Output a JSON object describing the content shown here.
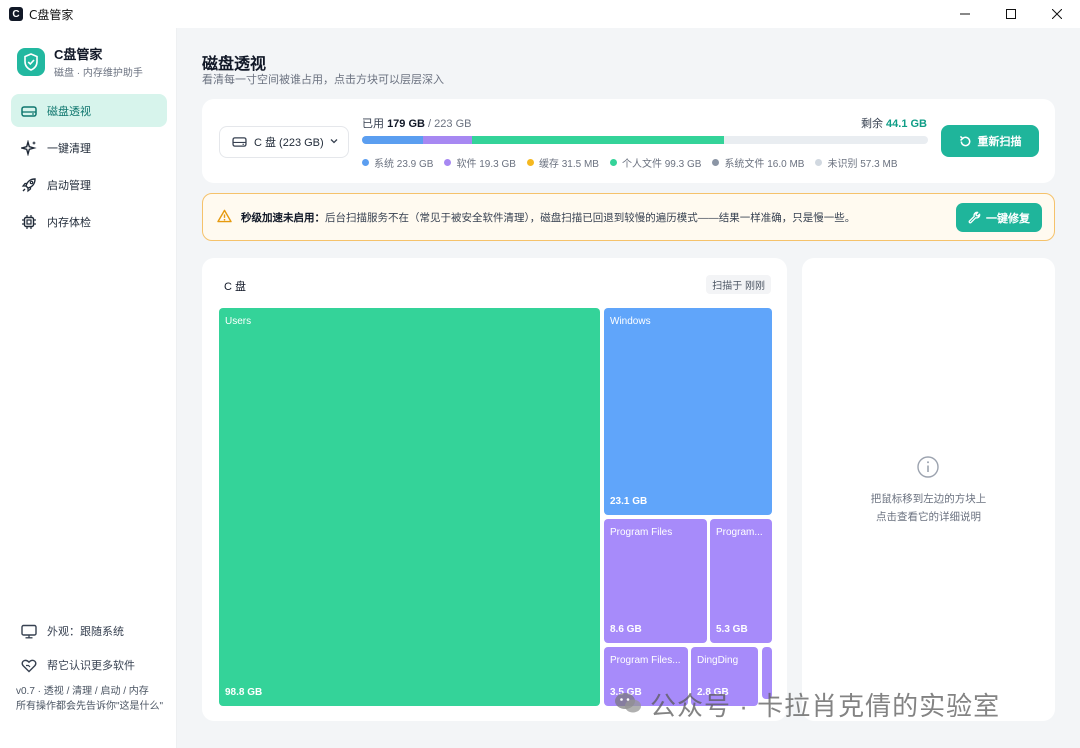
{
  "window": {
    "title": "C盘管家",
    "logo_glyph": "C"
  },
  "brand": {
    "name": "C盘管家",
    "subtitle": "磁盘 · 内存维护助手",
    "accent": "#22b8a0"
  },
  "nav": [
    {
      "label": "磁盘透视",
      "icon": "hard-drive-icon",
      "active": true
    },
    {
      "label": "一键清理",
      "icon": "sparkle-icon",
      "active": false
    },
    {
      "label": "启动管理",
      "icon": "rocket-icon",
      "active": false
    },
    {
      "label": "内存体检",
      "icon": "chip-icon",
      "active": false
    }
  ],
  "sidebar_bottom": {
    "appearance": "外观：跟随系统",
    "learn_more": "帮它认识更多软件",
    "footnote": "v0.7 · 透视 / 清理 / 启动 / 内存\n所有操作都会先告诉你\"这是什么\""
  },
  "page": {
    "title": "磁盘透视",
    "subtitle": "看清每一寸空间被谁占用，点击方块可以层层深入"
  },
  "usage": {
    "drive_label": "C 盘 (223 GB)",
    "used_prefix": "已用",
    "used_value": "179 GB",
    "used_total": "/ 223 GB",
    "free_prefix": "剩余",
    "free_value": "44.1 GB",
    "rescan_label": "重新扫描",
    "segments": [
      {
        "name": "系统",
        "label": "系统 23.9 GB",
        "color": "#5b9ef0",
        "gb": 23.9
      },
      {
        "name": "软件",
        "label": "软件 19.3 GB",
        "color": "#a788f2",
        "gb": 19.3
      },
      {
        "name": "缓存",
        "label": "缓存 31.5 MB",
        "color": "#f5b820",
        "gb": 0.03
      },
      {
        "name": "个人文件",
        "label": "个人文件 99.3 GB",
        "color": "#34d399",
        "gb": 99.3
      },
      {
        "name": "系统文件",
        "label": "系统文件 16.0 MB",
        "color": "#8b95a5",
        "gb": 0.016
      },
      {
        "name": "未识别",
        "label": "未识别 57.3 MB",
        "color": "#d1d8e0",
        "gb": 0.057
      }
    ]
  },
  "warning": {
    "title": "秒级加速未启用：",
    "body": "后台扫描服务不在（常见于被安全软件清理），磁盘扫描已回退到较慢的遍历模式——结果一样准确，只是慢一些。",
    "fix_label": "一键修复"
  },
  "treemap": {
    "title": "C 盘",
    "scan_badge": "扫描于 刚刚",
    "tiles": [
      {
        "name": "Users",
        "size": "98.8 GB",
        "color": "#34d399"
      },
      {
        "name": "Windows",
        "size": "23.1 GB",
        "color": "#60a5fa"
      },
      {
        "name": "Program Files",
        "size": "8.6 GB",
        "color": "#a78bfa"
      },
      {
        "name": "Program...",
        "size": "5.3 GB",
        "color": "#a78bfa"
      },
      {
        "name": "Program Files...",
        "size": "3.5 GB",
        "color": "#a78bfa"
      },
      {
        "name": "DingDing",
        "size": "2.8 GB",
        "color": "#a78bfa"
      },
      {
        "name": "",
        "size": "",
        "color": "#a78bfa"
      }
    ]
  },
  "detail": {
    "hint": "把鼠标移到左边的方块上\n点击查看它的详细说明"
  },
  "watermark": {
    "text": "公众号 · 卡拉肖克倩的实验室"
  }
}
